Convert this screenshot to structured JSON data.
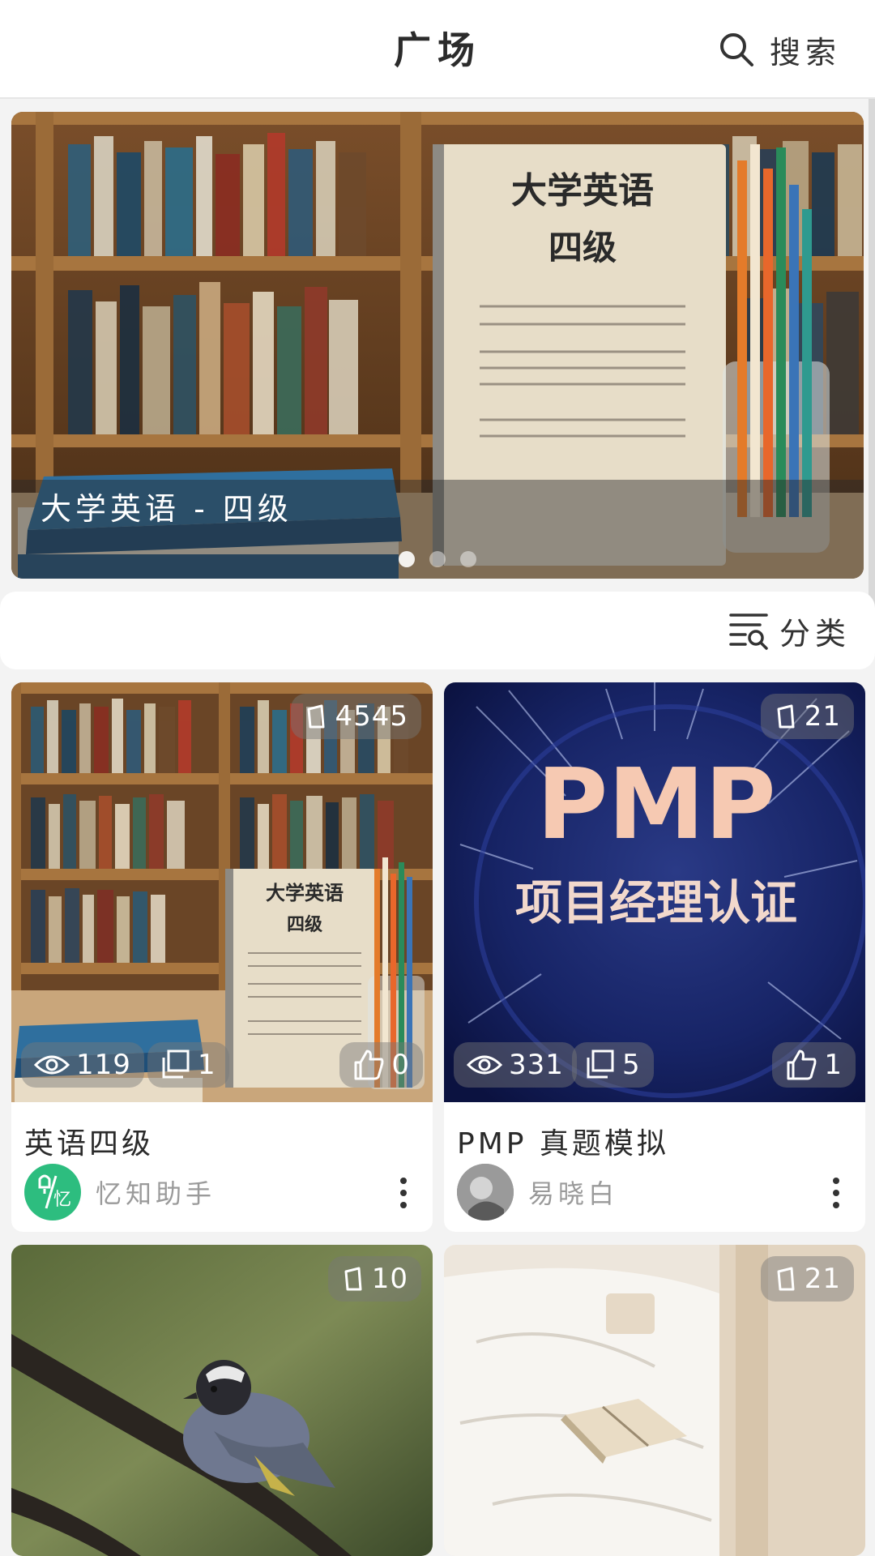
{
  "header": {
    "title": "广场",
    "search_label": "搜索"
  },
  "banner": {
    "caption": "大学英语 - 四级",
    "cover_title": "大学英语",
    "cover_subtitle": "四级",
    "dot_count": 3,
    "active_dot": 0
  },
  "filter": {
    "label": "分类"
  },
  "cards": [
    {
      "name": "英语四级",
      "card_count": "4545",
      "views": "119",
      "copies": "1",
      "likes": "0",
      "author": "忆知助手",
      "avatar_text": "忆",
      "cover_title": "大学英语",
      "cover_subtitle": "四级"
    },
    {
      "name": "PMP 真题模拟",
      "card_count": "21",
      "views": "331",
      "copies": "5",
      "likes": "1",
      "author": "易晓白",
      "cover_title": "PMP",
      "cover_subtitle": "项目经理认证"
    },
    {
      "name": "",
      "card_count": "10"
    },
    {
      "name": "",
      "card_count": "21"
    }
  ],
  "colors": {
    "accent_green": "#2dbd7f",
    "pmp_blue": "#1c2b6e",
    "pmp_text": "#f6c9b2"
  }
}
